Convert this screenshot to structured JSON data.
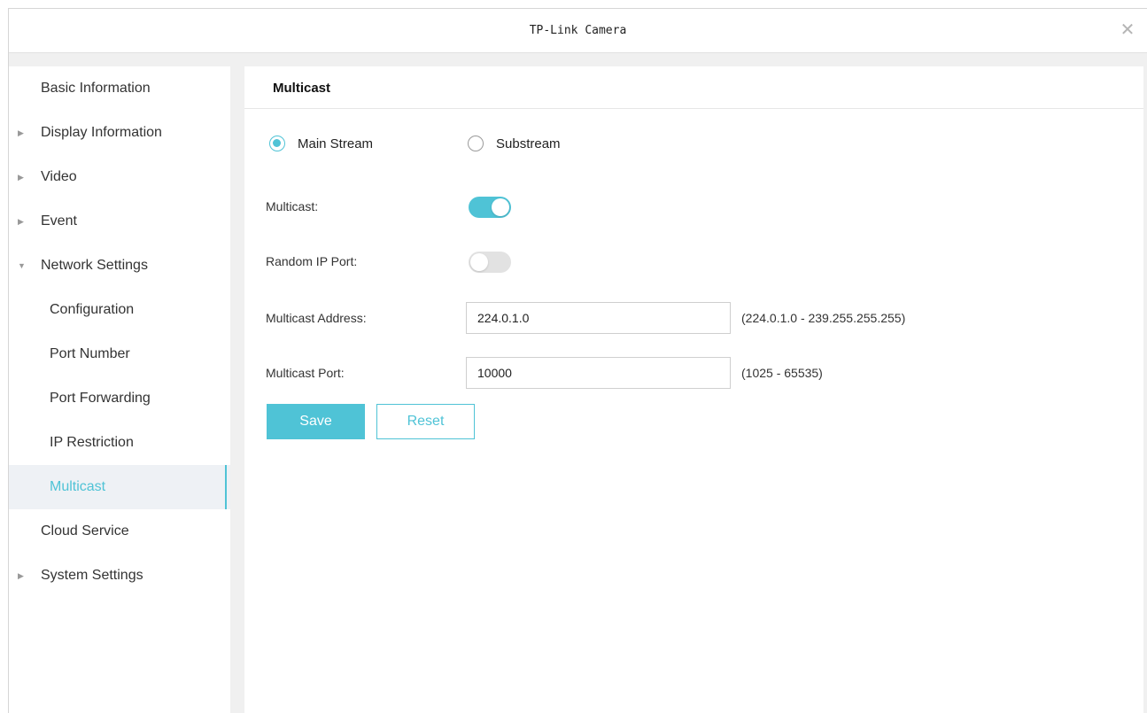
{
  "window": {
    "title": "TP-Link Camera",
    "close_glyph": "✕"
  },
  "colors": {
    "accent": "#4fc3d6",
    "sidebar_active_bg": "#eef1f5",
    "toggle_off": "#e2e2e2"
  },
  "sidebar": {
    "items": [
      {
        "label": "Basic Information",
        "arrow": "",
        "level": 0
      },
      {
        "label": "Display Information",
        "arrow": "▶",
        "level": 0
      },
      {
        "label": "Video",
        "arrow": "▶",
        "level": 0
      },
      {
        "label": "Event",
        "arrow": "▶",
        "level": 0
      },
      {
        "label": "Network Settings",
        "arrow": "▼",
        "level": 0
      },
      {
        "label": "Configuration",
        "arrow": "",
        "level": 1
      },
      {
        "label": "Port Number",
        "arrow": "",
        "level": 1
      },
      {
        "label": "Port Forwarding",
        "arrow": "",
        "level": 1
      },
      {
        "label": "IP Restriction",
        "arrow": "",
        "level": 1
      },
      {
        "label": "Multicast",
        "arrow": "",
        "level": 1,
        "active": true
      },
      {
        "label": "Cloud Service",
        "arrow": "",
        "level": 0
      },
      {
        "label": "System Settings",
        "arrow": "▶",
        "level": 0
      }
    ]
  },
  "main": {
    "section_title": "Multicast",
    "stream": {
      "options": [
        "Main Stream",
        "Substream"
      ],
      "selected": "Main Stream"
    },
    "multicast": {
      "label": "Multicast:",
      "enabled": true
    },
    "random_ip_port": {
      "label": "Random IP Port:",
      "enabled": false
    },
    "address": {
      "label": "Multicast Address:",
      "value": "224.0.1.0",
      "hint": "(224.0.1.0 - 239.255.255.255)"
    },
    "port": {
      "label": "Multicast Port:",
      "value": "10000",
      "hint": "(1025 - 65535)"
    },
    "buttons": {
      "save": "Save",
      "reset": "Reset"
    }
  }
}
